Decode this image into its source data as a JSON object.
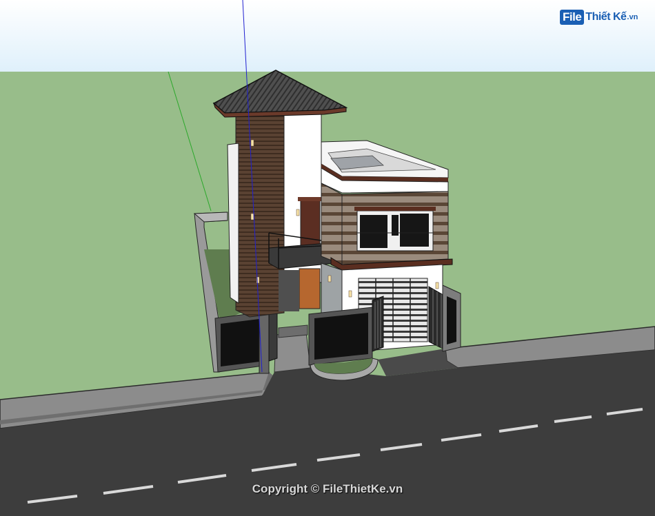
{
  "watermark": {
    "logo_file": "File",
    "logo_name": "Thiết Kế",
    "logo_ext": ".vn",
    "copyright": "Copyright © FileThietKe.vn"
  },
  "colors": {
    "sky_top": "#ffffff",
    "sky_bottom": "#e6f3fd",
    "lawn": "#98bd8a",
    "road": "#3d3d3d",
    "sidewalk": "#8a8a8a",
    "roof": "#4a4a4a",
    "wood": "#5a4030",
    "wall": "#ffffff",
    "brand": "#1a5fb4"
  }
}
